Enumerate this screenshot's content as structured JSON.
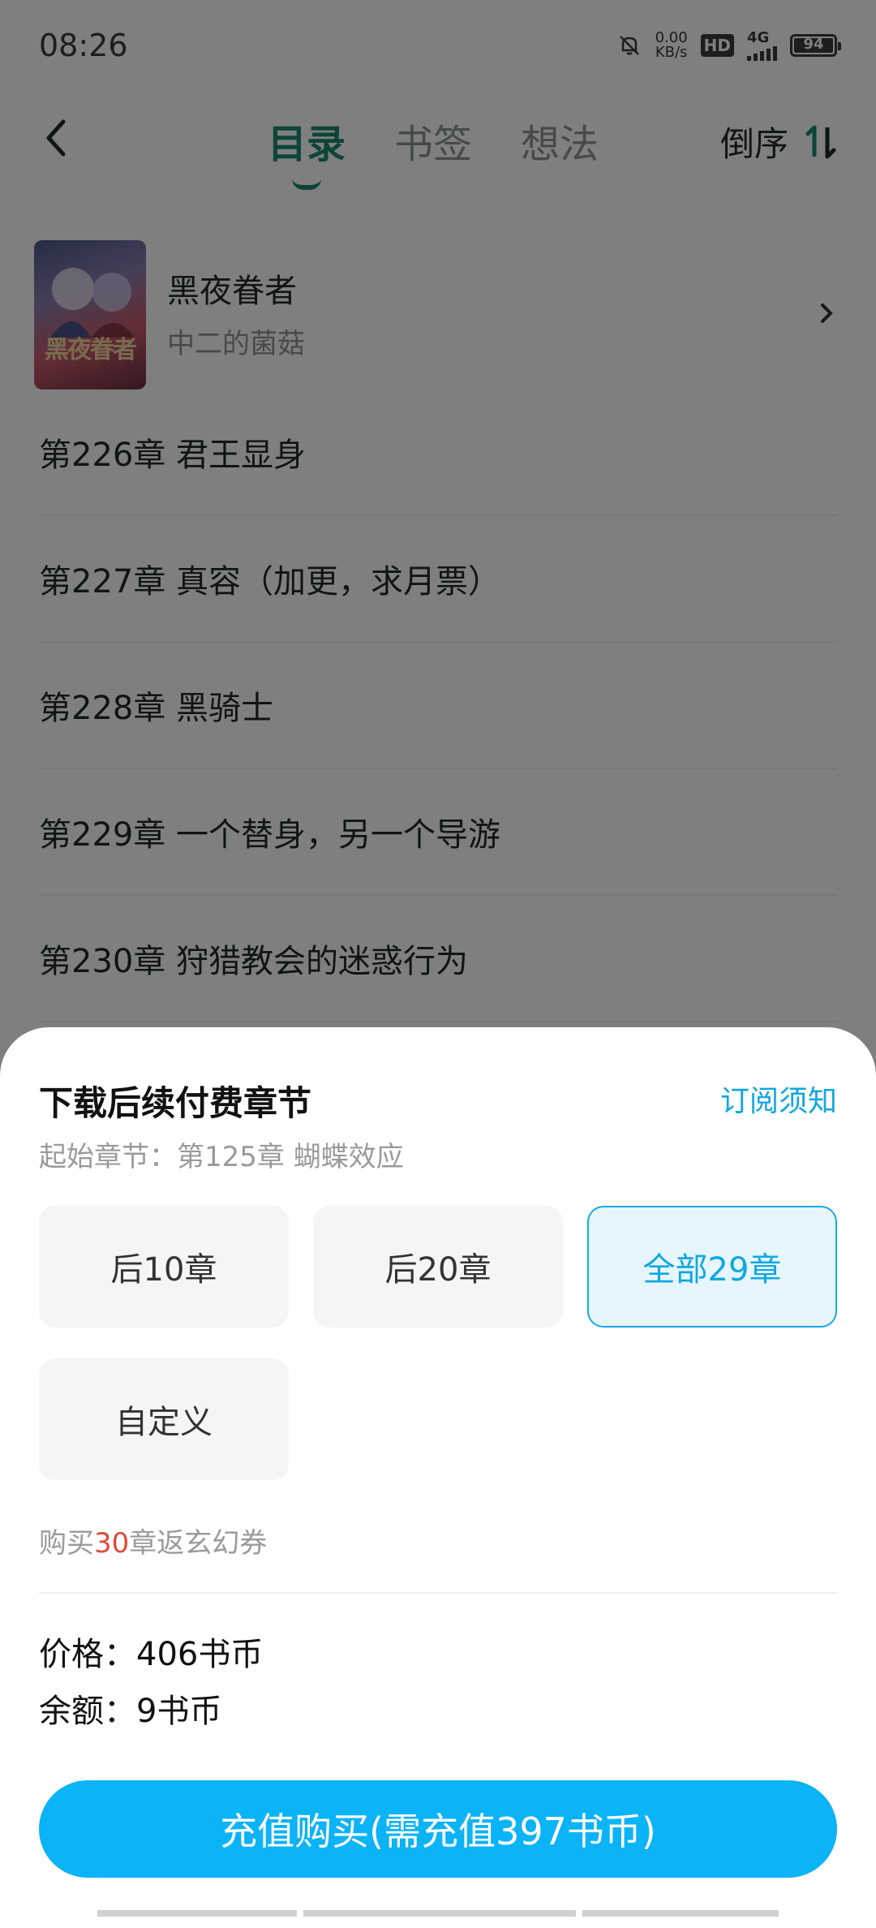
{
  "status_bar": {
    "time": "08:26",
    "speed_value": "0.00",
    "speed_unit": "KB/s",
    "hd": "HD",
    "network": "4G",
    "battery": "94"
  },
  "nav": {
    "tabs": [
      {
        "label": "目录",
        "active": true
      },
      {
        "label": "书签",
        "active": false
      },
      {
        "label": "想法",
        "active": false
      }
    ],
    "sort_label": "倒序"
  },
  "book": {
    "cover_text": "黑夜眷者",
    "title": "黑夜眷者",
    "author": "中二的菌菇"
  },
  "chapters": [
    "第226章 君王显身",
    "第227章 真容（加更，求月票）",
    "第228章 黑骑士",
    "第229章 一个替身，另一个导游",
    "第230章 狩猎教会的迷惑行为"
  ],
  "sheet": {
    "title": "下载后续付费章节",
    "notice_link": "订阅须知",
    "start_chapter": "起始章节：第125章 蝴蝶效应",
    "options": [
      {
        "label": "后10章",
        "selected": false
      },
      {
        "label": "后20章",
        "selected": false
      },
      {
        "label": "全部29章",
        "selected": true
      },
      {
        "label": "自定义",
        "selected": false
      }
    ],
    "promo_prefix": "购买",
    "promo_count": "30",
    "promo_suffix": "章返玄幻券",
    "price": "价格：406书币",
    "balance": "余额：9书币",
    "buy_button": "充值购买(需充值397书币)"
  },
  "colors": {
    "accent_green": "#1a8872",
    "accent_blue": "#0bb3f7",
    "promo_red": "#e04a3c"
  }
}
